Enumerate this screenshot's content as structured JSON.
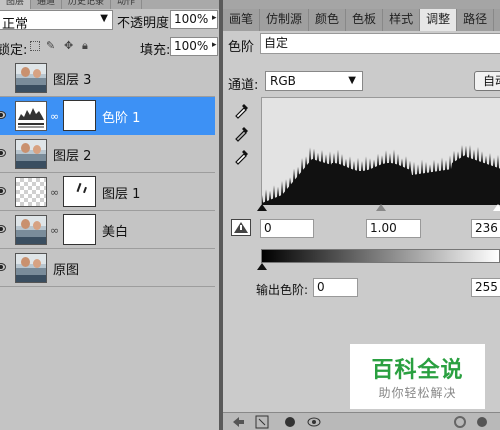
{
  "layers_panel": {
    "tabs": [
      "图层",
      "通道",
      "历史记录",
      "动作"
    ],
    "blend_mode": "正常",
    "opacity_label": "不透明度:",
    "opacity_value": "100%",
    "lock_label": "锁定:",
    "fill_label": "填充:",
    "fill_value": "100%",
    "layers": [
      {
        "name": "图层 3",
        "visible": false,
        "thumb": "photo",
        "mask": false,
        "selected": false
      },
      {
        "name": "色阶 1",
        "visible": true,
        "thumb": "levels-adjustment",
        "mask": true,
        "selected": true
      },
      {
        "name": "图层 2",
        "visible": true,
        "thumb": "photo",
        "mask": false,
        "selected": false
      },
      {
        "name": "图层 1",
        "visible": true,
        "thumb": "transparent",
        "mask": true,
        "selected": false
      },
      {
        "name": "美白",
        "visible": true,
        "thumb": "photo",
        "mask": true,
        "selected": false
      },
      {
        "name": "原图",
        "visible": true,
        "thumb": "photo",
        "mask": false,
        "selected": false
      }
    ],
    "selection_color": "#3d91f5"
  },
  "adjust_panel": {
    "tabs": [
      "画笔",
      "仿制源",
      "颜色",
      "色板",
      "样式",
      "调整",
      "路径"
    ],
    "active_tab": "调整",
    "preset_label": "色阶",
    "preset_value": "自定",
    "channel_label": "通道:",
    "channel_value": "RGB",
    "auto_button": "自动",
    "input_black": "0",
    "input_gamma": "1.00",
    "input_white": "236",
    "output_label": "输出色阶:",
    "output_black": "0",
    "output_white": "255"
  },
  "watermark": {
    "title": "百科全说",
    "subtitle": "助你轻松解决",
    "color": "#2aa040"
  }
}
